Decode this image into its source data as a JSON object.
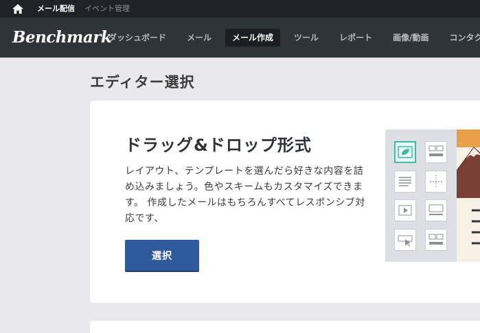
{
  "topbar": {
    "links": [
      "メール配信",
      "イベント管理"
    ]
  },
  "navbar": {
    "logo": "Benchmark",
    "items": [
      "ダッシュボード",
      "メール",
      "メール作成",
      "ツール",
      "レポート",
      "画像/動画",
      "コンタクト"
    ]
  },
  "page": {
    "title": "エディター選択"
  },
  "card": {
    "title": "ドラッグ&ドロップ形式",
    "description": "レイアウト、テンプレートを選んだら好きな内容を詰め込みましょう。色やスキームもカスタマイズできます。 作成したメールはもちろんすべてレスポンシブ対応です、",
    "button_label": "選択"
  },
  "colors": {
    "topbar_bg": "#1f2226",
    "navbar_bg": "#2f3439",
    "button_bg": "#2f5b9c",
    "accent_teal": "#3dbba3",
    "illustration_orange": "#e8a04a",
    "illustration_brown": "#7a3f35"
  }
}
